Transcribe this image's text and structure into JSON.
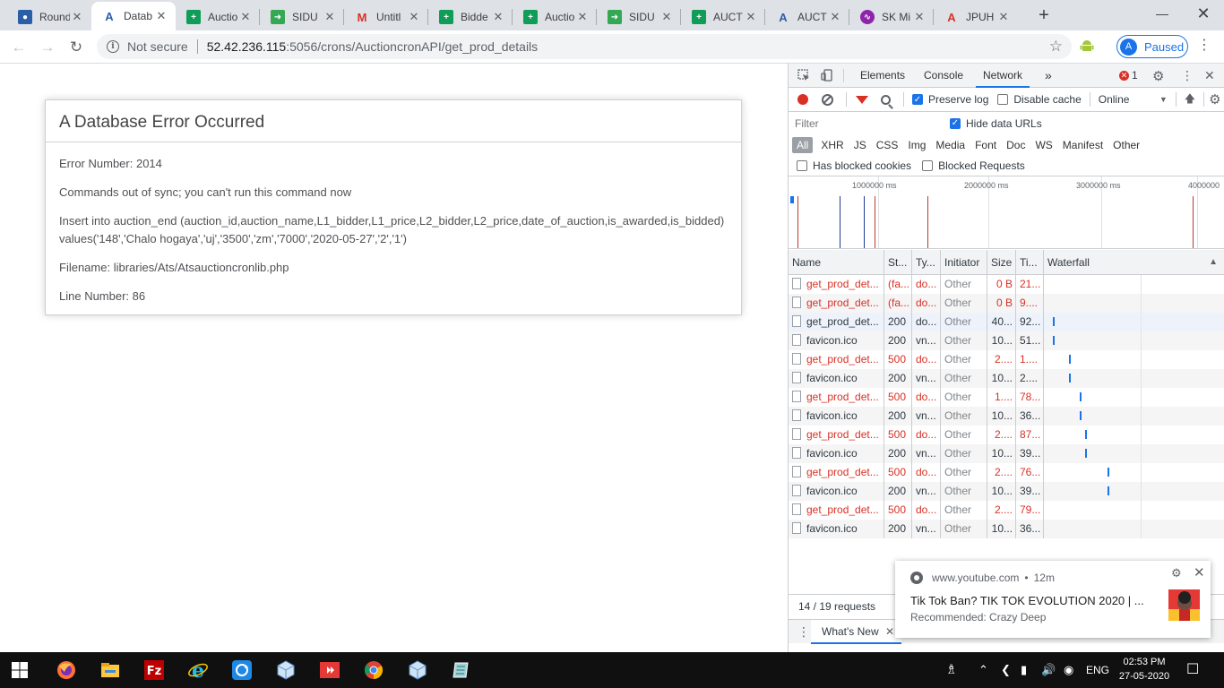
{
  "browser": {
    "tabs": [
      {
        "title": "Round",
        "icon": "globe-icon"
      },
      {
        "title": "Datab",
        "icon": "app-logo-icon"
      },
      {
        "title": "Auctio",
        "icon": "sheets-icon"
      },
      {
        "title": "SIDU",
        "icon": "arrow-icon"
      },
      {
        "title": "Untitl",
        "icon": "gmail-icon"
      },
      {
        "title": "Bidde",
        "icon": "sheets-icon"
      },
      {
        "title": "Auctio",
        "icon": "sheets-icon"
      },
      {
        "title": "SIDU",
        "icon": "arrow-icon"
      },
      {
        "title": "AUCT",
        "icon": "sheets-icon"
      },
      {
        "title": "AUCT",
        "icon": "app-logo-icon"
      },
      {
        "title": "SK Mi",
        "icon": "music-icon"
      },
      {
        "title": "JPUH",
        "icon": "pdf-icon"
      }
    ],
    "security_label": "Not secure",
    "url_host": "52.42.236.115",
    "url_rest": ":5056/crons/AuctioncronAPI/get_prod_details",
    "profile_initial": "A",
    "profile_status": "Paused"
  },
  "error_page": {
    "heading": "A Database Error Occurred",
    "error_number": "Error Number: 2014",
    "message": "Commands out of sync; you can't run this command now",
    "query": "Insert into auction_end (auction_id,auction_name,L1_bidder,L1_price,L2_bidder,L2_price,date_of_auction,is_awarded,is_bidded) values('148','Chalo hogaya','uj','3500','zm','7000','2020-05-27','2','1')",
    "filename": "Filename: libraries/Ats/Atsauctioncronlib.php",
    "line_number": "Line Number: 86"
  },
  "devtools": {
    "tabs": [
      "Elements",
      "Console",
      "Network"
    ],
    "more": "»",
    "error_count": "1",
    "preserve_log": "Preserve log",
    "disable_cache": "Disable cache",
    "throttle": "Online",
    "filter_placeholder": "Filter",
    "hide_data_urls": "Hide data URLs",
    "types": [
      "All",
      "XHR",
      "JS",
      "CSS",
      "Img",
      "Media",
      "Font",
      "Doc",
      "WS",
      "Manifest",
      "Other"
    ],
    "has_blocked_cookies": "Has blocked cookies",
    "blocked_requests": "Blocked Requests",
    "timeline_labels": [
      "1000000 ms",
      "2000000 ms",
      "3000000 ms",
      "4000000"
    ],
    "columns": [
      "Name",
      "St...",
      "Ty...",
      "Initiator",
      "Size",
      "Ti...",
      "Waterfall"
    ],
    "rows": [
      {
        "name": "get_prod_det...",
        "status": "(fa...",
        "type": "do...",
        "initiator": "Other",
        "size": "0 B",
        "time": "21...",
        "error": true,
        "wf": 0
      },
      {
        "name": "get_prod_det...",
        "status": "(fa...",
        "type": "do...",
        "initiator": "Other",
        "size": "0 B",
        "time": "9....",
        "error": true,
        "wf": 0
      },
      {
        "name": "get_prod_det...",
        "status": "200",
        "type": "do...",
        "initiator": "Other",
        "size": "40...",
        "time": "92...",
        "error": false,
        "wf": 0.04
      },
      {
        "name": "favicon.ico",
        "status": "200",
        "type": "vn...",
        "initiator": "Other",
        "size": "10...",
        "time": "51...",
        "error": false,
        "wf": 0.04
      },
      {
        "name": "get_prod_det...",
        "status": "500",
        "type": "do...",
        "initiator": "Other",
        "size": "2....",
        "time": "1....",
        "error": true,
        "wf": 0.13
      },
      {
        "name": "favicon.ico",
        "status": "200",
        "type": "vn...",
        "initiator": "Other",
        "size": "10...",
        "time": "2....",
        "error": false,
        "wf": 0.13
      },
      {
        "name": "get_prod_det...",
        "status": "500",
        "type": "do...",
        "initiator": "Other",
        "size": "1....",
        "time": "78...",
        "error": true,
        "wf": 0.19
      },
      {
        "name": "favicon.ico",
        "status": "200",
        "type": "vn...",
        "initiator": "Other",
        "size": "10...",
        "time": "36...",
        "error": false,
        "wf": 0.19
      },
      {
        "name": "get_prod_det...",
        "status": "500",
        "type": "do...",
        "initiator": "Other",
        "size": "2....",
        "time": "87...",
        "error": true,
        "wf": 0.22
      },
      {
        "name": "favicon.ico",
        "status": "200",
        "type": "vn...",
        "initiator": "Other",
        "size": "10...",
        "time": "39...",
        "error": false,
        "wf": 0.22
      },
      {
        "name": "get_prod_det...",
        "status": "500",
        "type": "do...",
        "initiator": "Other",
        "size": "2....",
        "time": "76...",
        "error": true,
        "wf": 0.34
      },
      {
        "name": "favicon.ico",
        "status": "200",
        "type": "vn...",
        "initiator": "Other",
        "size": "10...",
        "time": "39...",
        "error": false,
        "wf": 0.34
      },
      {
        "name": "get_prod_det...",
        "status": "500",
        "type": "do...",
        "initiator": "Other",
        "size": "2....",
        "time": "79...",
        "error": true,
        "wf": 0
      },
      {
        "name": "favicon.ico",
        "status": "200",
        "type": "vn...",
        "initiator": "Other",
        "size": "10...",
        "time": "36...",
        "error": false,
        "wf": 0
      }
    ],
    "requests_summary": "14 / 19 requests",
    "drawer_tab": "What's New"
  },
  "notification": {
    "source": "www.youtube.com",
    "age": "12m",
    "title": "Tik Tok Ban? TIK TOK EVOLUTION 2020 | ...",
    "subtitle": "Recommended: Crazy Deep"
  },
  "taskbar": {
    "language": "ENG",
    "time": "02:53 PM",
    "date": "27-05-2020"
  }
}
